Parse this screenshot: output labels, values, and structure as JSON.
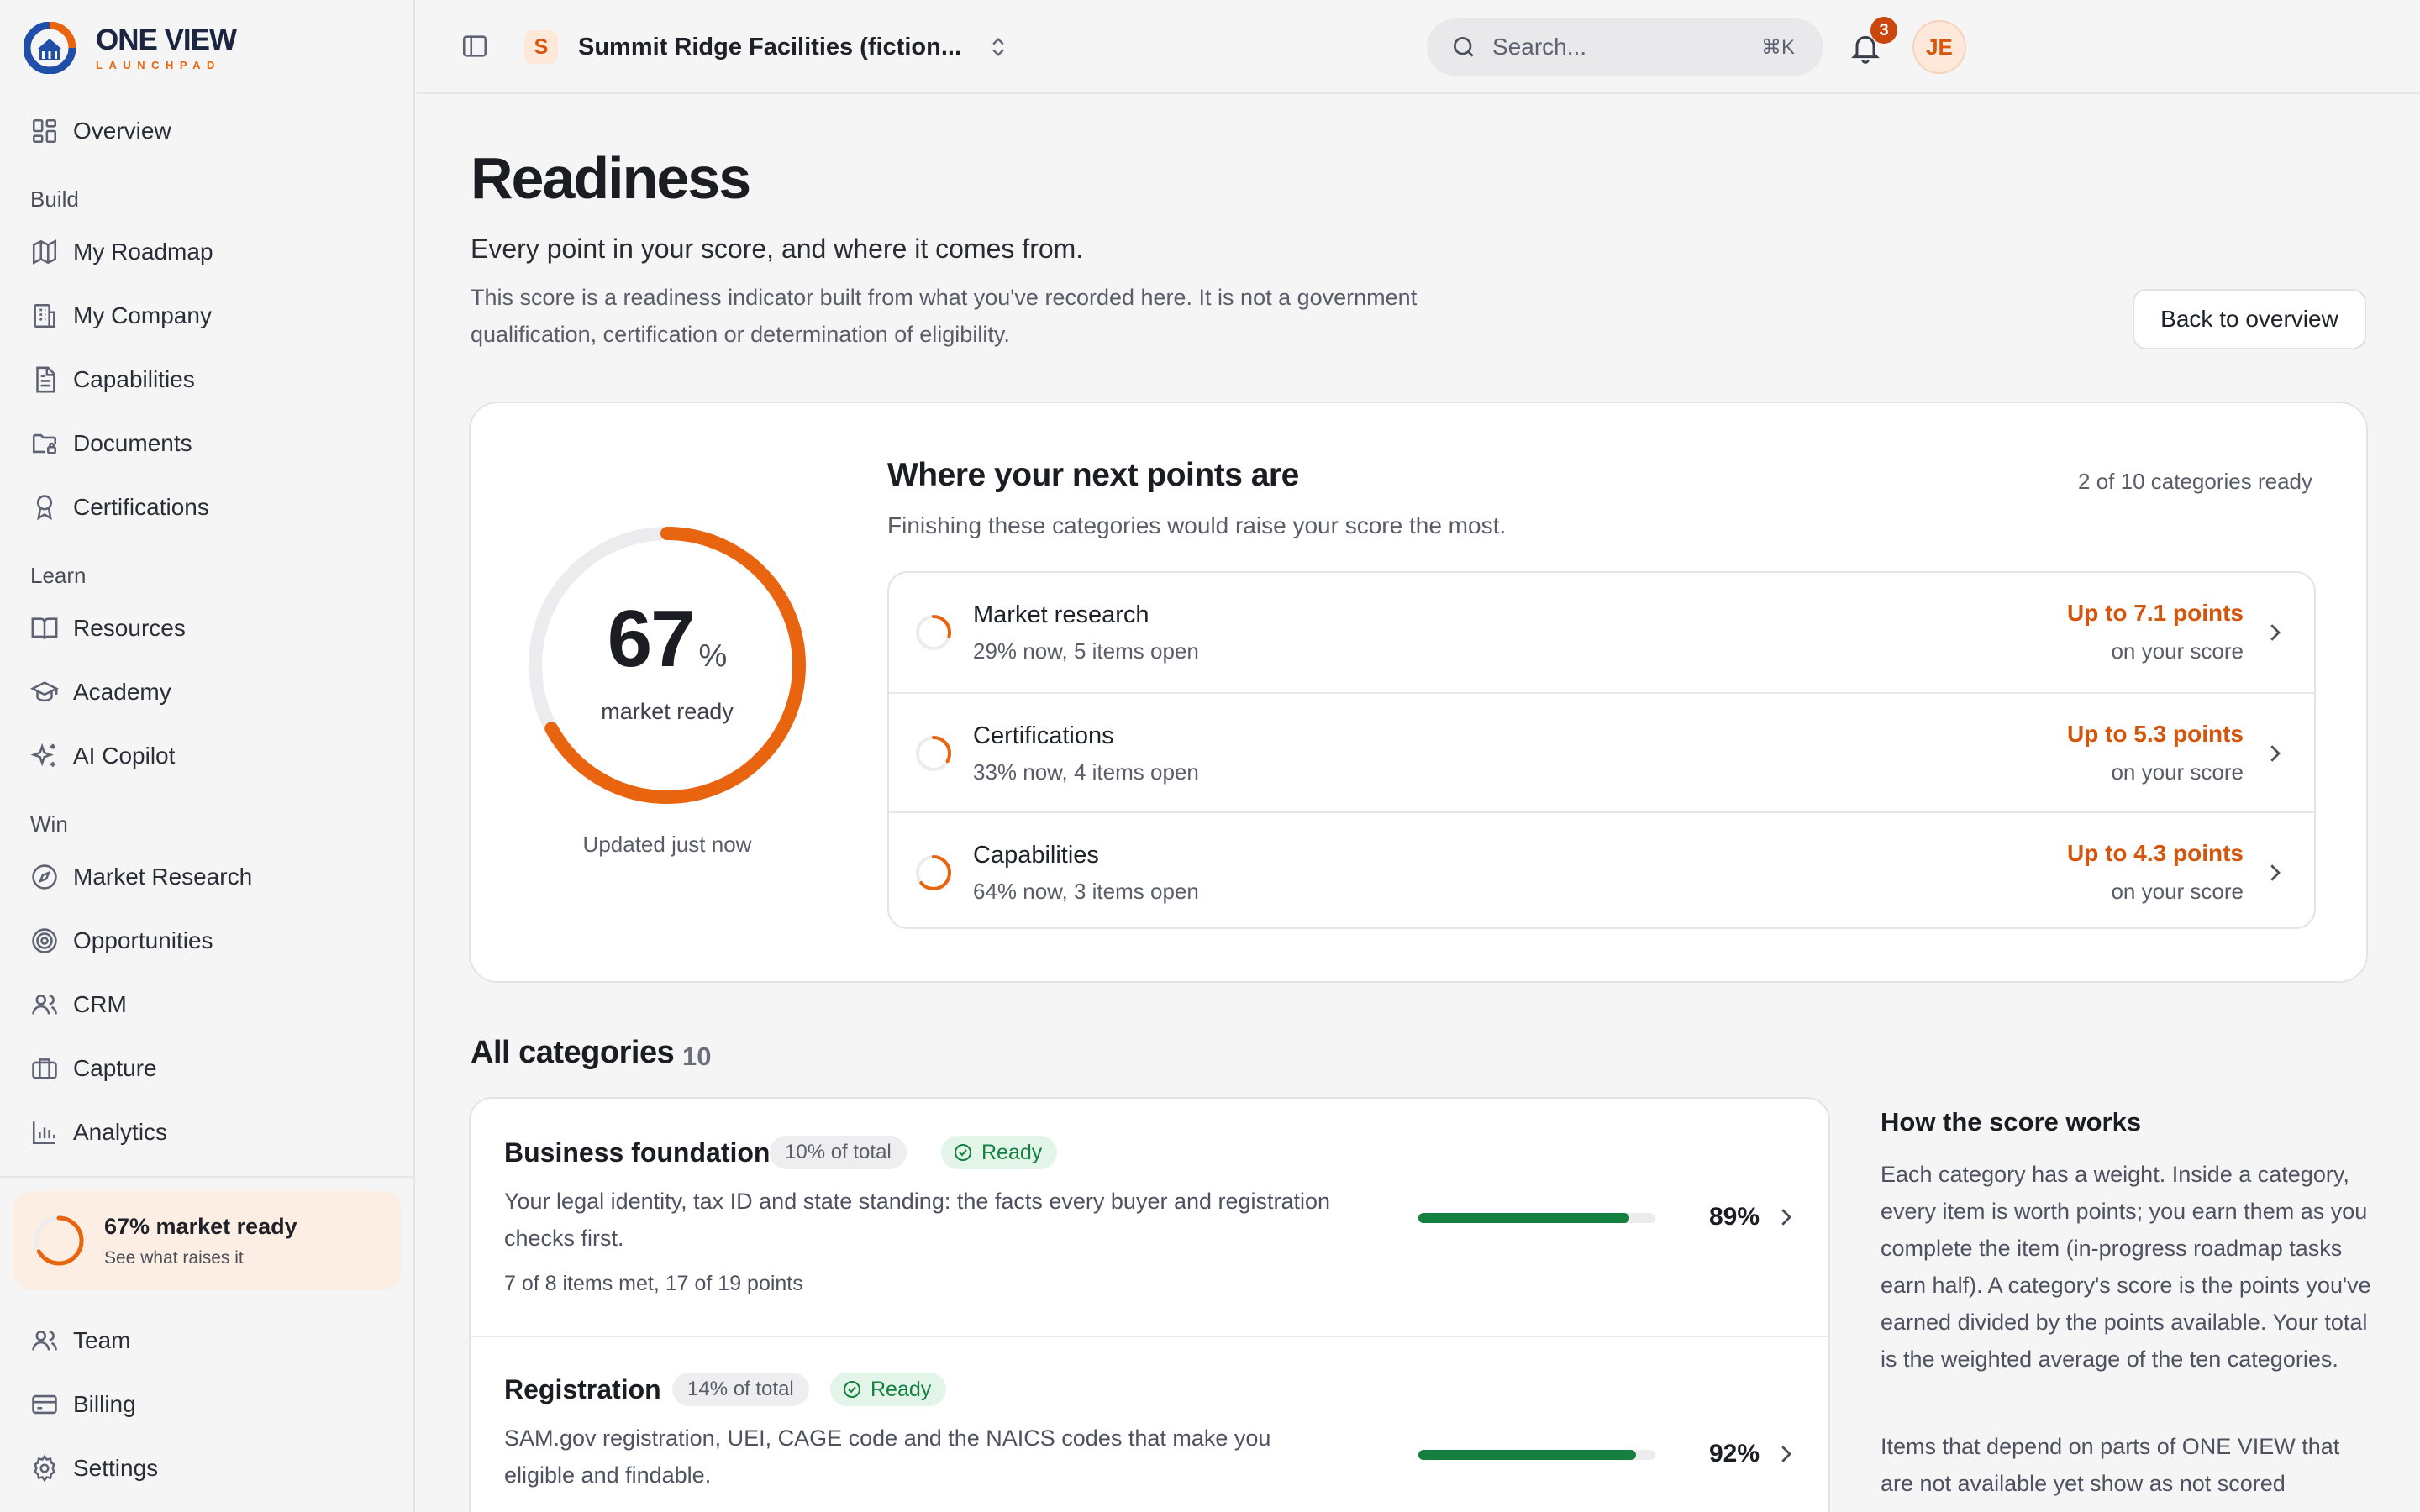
{
  "brand": {
    "name": "ONE VIEW",
    "sub": "LAUNCHPAD"
  },
  "sidebar": {
    "overview": "Overview",
    "sections": {
      "build": "Build",
      "learn": "Learn",
      "win": "Win"
    },
    "build": [
      "My Roadmap",
      "My Company",
      "Capabilities",
      "Documents",
      "Certifications"
    ],
    "learn": [
      "Resources",
      "Academy",
      "AI Copilot"
    ],
    "win": [
      "Market Research",
      "Opportunities",
      "CRM",
      "Capture",
      "Analytics"
    ],
    "ready_card": {
      "title": "67% market ready",
      "subtitle": "See what raises it",
      "progress": 0.67
    },
    "footer": [
      "Team",
      "Billing",
      "Settings"
    ]
  },
  "topbar": {
    "org_initial": "S",
    "org_name": "Summit Ridge Facilities (fiction...",
    "search_placeholder": "Search...",
    "search_shortcut": "⌘K",
    "notification_count": "3",
    "user_initials": "JE"
  },
  "page": {
    "title": "Readiness",
    "subtitle": "Every point in your score, and where it comes from.",
    "description": "This score is a readiness indicator built from what you've recorded here. It is not a government qualification, certification or determination of eligibility.",
    "back_button": "Back to overview"
  },
  "score": {
    "value": "67",
    "unit": "%",
    "label": "market ready",
    "updated": "Updated just now",
    "progress": 0.67
  },
  "next_points": {
    "title": "Where your next points are",
    "count": "2 of 10 categories ready",
    "subtitle": "Finishing these categories would raise your score the most.",
    "items": [
      {
        "name": "Market research",
        "status": "29% now, 5 items open",
        "points": "Up to 7.1 points",
        "points_sub": "on your score",
        "progress": 0.29
      },
      {
        "name": "Certifications",
        "status": "33% now, 4 items open",
        "points": "Up to 5.3 points",
        "points_sub": "on your score",
        "progress": 0.33
      },
      {
        "name": "Capabilities",
        "status": "64% now, 3 items open",
        "points": "Up to 4.3 points",
        "points_sub": "on your score",
        "progress": 0.64
      }
    ]
  },
  "categories": {
    "title": "All categories",
    "count": "10",
    "items": [
      {
        "name": "Business foundation",
        "weight": "10% of total",
        "status": "Ready",
        "description": "Your legal identity, tax ID and state standing: the facts every buyer and registration checks first.",
        "meta": "7 of 8 items met, 17 of 19 points",
        "percent": "89%",
        "progress": 0.89
      },
      {
        "name": "Registration",
        "weight": "14% of total",
        "status": "Ready",
        "description": "SAM.gov registration, UEI, CAGE code and the NAICS codes that make you eligible and findable.",
        "percent": "92%",
        "progress": 0.92
      }
    ]
  },
  "how": {
    "title": "How the score works",
    "p1": "Each category has a weight. Inside a category, every item is worth points; you earn them as you complete the item (in-progress roadmap tasks earn half). A category's score is the points you've earned divided by the points available. Your total is the weighted average of the ten categories.",
    "p2": "Items that depend on parts of ONE VIEW that are not available yet show as not scored"
  },
  "colors": {
    "accent": "#e9640f",
    "accent_dark": "#d4560d",
    "ready_green": "#13803f",
    "track": "#ececef"
  }
}
